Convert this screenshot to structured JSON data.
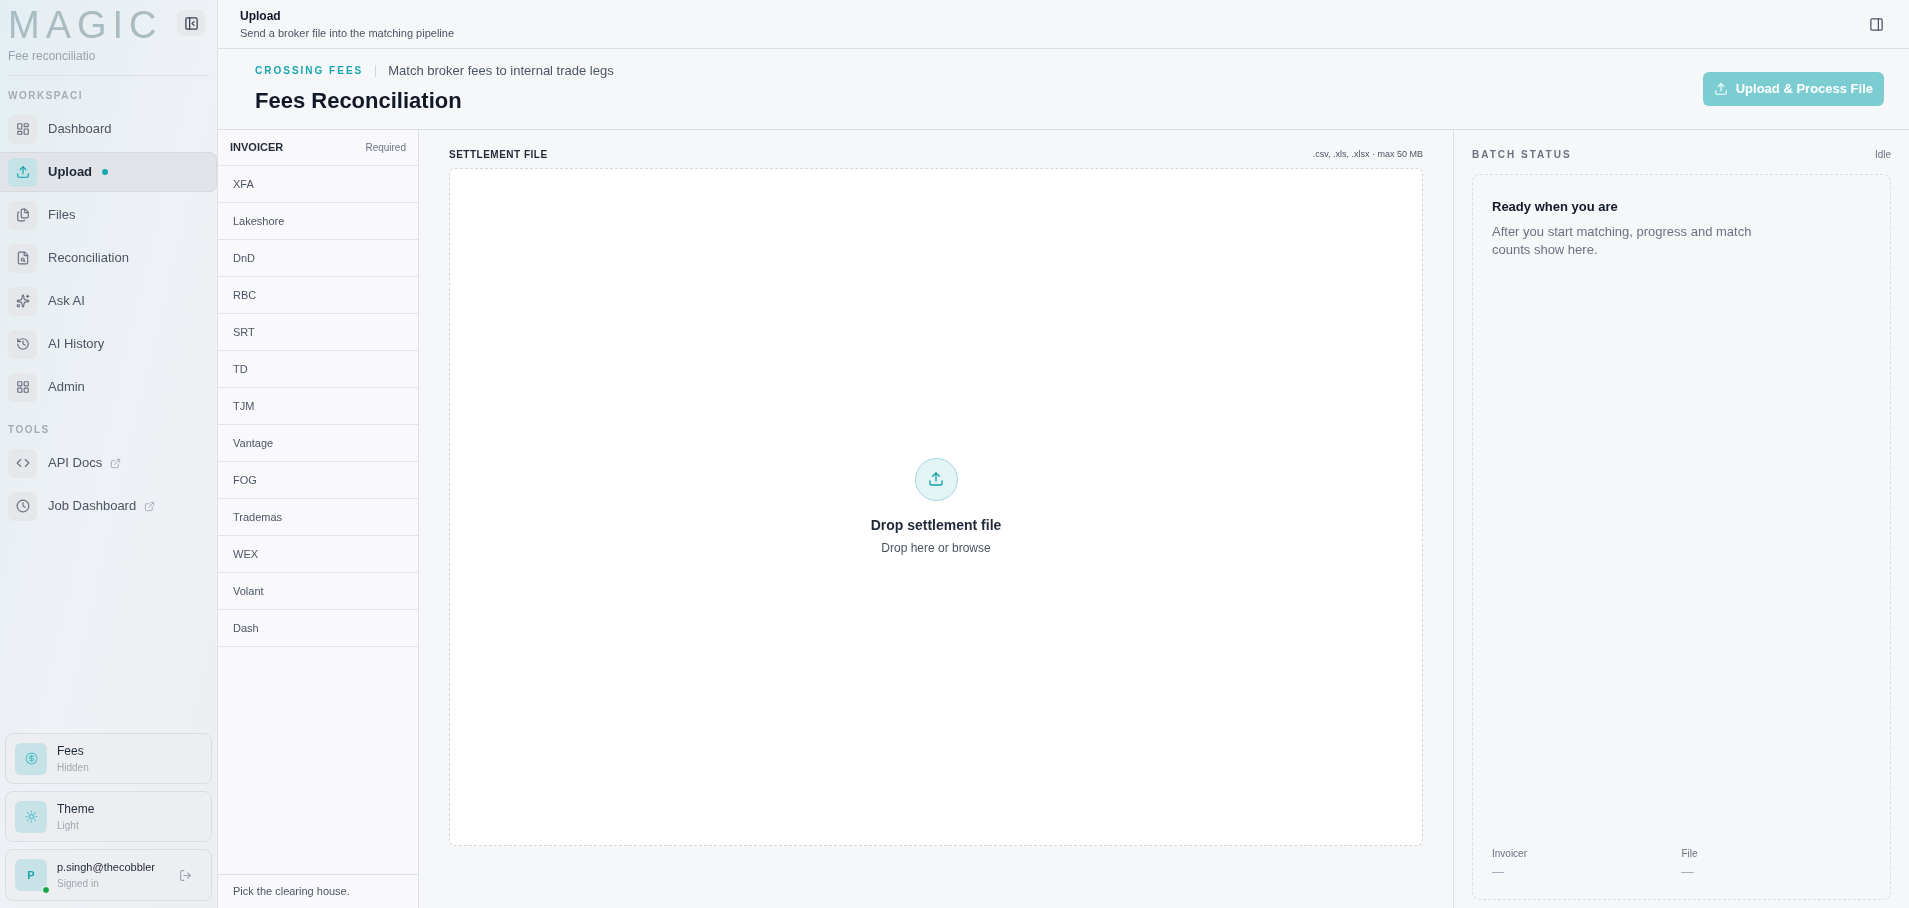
{
  "sidebar": {
    "logo": "MAGIC",
    "subtitle": "Fee reconciliatio",
    "sections": [
      {
        "title": "WORKSPACI",
        "items": [
          {
            "label": "Dashboard",
            "selected": false,
            "badge": false,
            "external": false
          },
          {
            "label": "Upload",
            "selected": true,
            "badge": true,
            "external": false
          },
          {
            "label": "Files",
            "selected": false,
            "badge": false,
            "external": false
          },
          {
            "label": "Reconciliation",
            "selected": false,
            "badge": false,
            "external": false
          },
          {
            "label": "Ask AI",
            "selected": false,
            "badge": false,
            "external": false
          },
          {
            "label": "AI History",
            "selected": false,
            "badge": false,
            "external": false
          },
          {
            "label": "Admin",
            "selected": false,
            "badge": false,
            "external": false
          }
        ]
      },
      {
        "title": "TOOLS",
        "items": [
          {
            "label": "API Docs",
            "selected": false,
            "badge": false,
            "external": true
          },
          {
            "label": "Job Dashboard",
            "selected": false,
            "badge": false,
            "external": true
          }
        ]
      }
    ],
    "cards": [
      {
        "title": "Fees",
        "subtitle": "Hidden"
      },
      {
        "title": "Theme",
        "subtitle": "Light"
      }
    ],
    "user": {
      "initial": "P",
      "email": "p.singh@thecobbler",
      "status": "Signed in",
      "online": true
    }
  },
  "topbar": {
    "title": "Upload",
    "subtitle": "Send a broker file into the matching pipeline"
  },
  "page": {
    "eyebrow": "CROSSING FEES",
    "tagline": "Match broker fees to internal trade legs",
    "title": "Fees Reconciliation",
    "action": {
      "label": "Upload & Process File",
      "disabled": true
    }
  },
  "invoicer": {
    "title": "INVOICER",
    "hint": "Required",
    "footer": "Pick the clearing house.",
    "options": [
      {
        "label": "XFA",
        "selected": false
      },
      {
        "label": "Lakeshore",
        "selected": false
      },
      {
        "label": "DnD",
        "selected": false
      },
      {
        "label": "RBC",
        "selected": false
      },
      {
        "label": "SRT",
        "selected": false
      },
      {
        "label": "TD",
        "selected": false
      },
      {
        "label": "TJM",
        "selected": false
      },
      {
        "label": "Vantage",
        "selected": false
      },
      {
        "label": "FOG",
        "selected": false
      },
      {
        "label": "Trademas",
        "selected": false
      },
      {
        "label": "WEX",
        "selected": false
      },
      {
        "label": "Volant",
        "selected": false
      },
      {
        "label": "Dash",
        "selected": false
      }
    ]
  },
  "settlement": {
    "title": "SETTLEMENT FILE",
    "formats": ".csv, .xls, .xlsx · max 50 MB",
    "drop_title": "Drop settlement file",
    "drop_hint": "Drop here or browse"
  },
  "batch": {
    "title": "BATCH STATUS",
    "state": "Idle",
    "heading": "Ready when you are",
    "body": "After you start matching, progress and match counts show here.",
    "fields": [
      {
        "label": "Invoicer",
        "value": "—"
      },
      {
        "label": "File",
        "value": "—"
      }
    ]
  }
}
